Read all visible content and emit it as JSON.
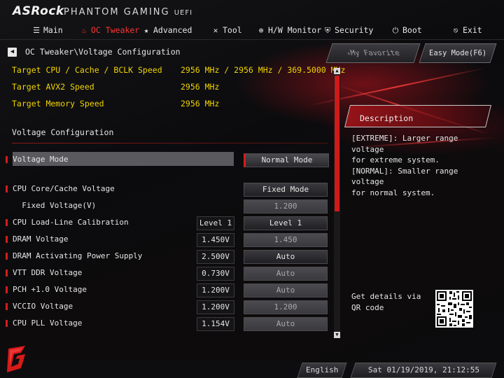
{
  "header": {
    "brand": "ASRock",
    "product": "PHANTOM GAMING",
    "uefi": "UEFI"
  },
  "nav": {
    "items": [
      {
        "label": "Main",
        "icon": "list-icon"
      },
      {
        "label": "OC Tweaker",
        "icon": "flame-icon",
        "active": true
      },
      {
        "label": "Advanced",
        "icon": "star-icon"
      },
      {
        "label": "Tool",
        "icon": "tool-icon"
      },
      {
        "label": "H/W Monitor",
        "icon": "monitor-icon"
      },
      {
        "label": "Security",
        "icon": "shield-icon"
      },
      {
        "label": "Boot",
        "icon": "power-icon"
      },
      {
        "label": "Exit",
        "icon": "exit-icon"
      }
    ]
  },
  "breadcrumb": "OC Tweaker\\Voltage Configuration",
  "buttons": {
    "my_favorite": "My Favorite",
    "easy_mode": "Easy Mode(F6)"
  },
  "info": [
    {
      "label": "Target CPU / Cache / BCLK Speed",
      "value": "2956 MHz / 2956 MHz / 369.5000 MHz"
    },
    {
      "label": "Target AVX2 Speed",
      "value": "2956 MHz"
    },
    {
      "label": "Target Memory Speed",
      "value": "2956 MHz"
    }
  ],
  "section_title": "Voltage Configuration",
  "settings": [
    {
      "label": "Voltage Mode",
      "current": "",
      "value": "Normal Mode",
      "selected": true,
      "marker": true
    },
    {
      "label": "CPU Core/Cache Voltage",
      "current": "",
      "value": "Fixed Mode",
      "marker": true
    },
    {
      "label": "  Fixed Voltage(V)",
      "current": "",
      "value": "1.200",
      "dim": true,
      "marker": false
    },
    {
      "label": "CPU Load-Line Calibration",
      "current": "Level 1",
      "value": "Level 1",
      "marker": true
    },
    {
      "label": "DRAM Voltage",
      "current": "1.450V",
      "value": "1.450",
      "dim": true,
      "marker": true
    },
    {
      "label": "DRAM Activating Power Supply",
      "current": "2.500V",
      "value": "Auto",
      "marker": true
    },
    {
      "label": "VTT DDR Voltage",
      "current": "0.730V",
      "value": "Auto",
      "dim": true,
      "marker": true
    },
    {
      "label": "PCH +1.0 Voltage",
      "current": "1.200V",
      "value": "Auto",
      "dim": true,
      "marker": true
    },
    {
      "label": "VCCIO Voltage",
      "current": "1.200V",
      "value": "1.200",
      "dim": true,
      "marker": true
    },
    {
      "label": "CPU PLL Voltage",
      "current": "1.154V",
      "value": "Auto",
      "dim": true,
      "marker": true
    }
  ],
  "description": {
    "title": "Description",
    "lines": [
      "[EXTREME]: Larger range voltage",
      "for extreme system.",
      "[NORMAL]: Smaller range voltage",
      "for normal system."
    ]
  },
  "qr_label": "Get details via QR code",
  "footer": {
    "language": "English",
    "datetime": "Sat 01/19/2019, 21:12:55"
  },
  "colors": {
    "accent": "#d61c1c",
    "info_text": "#f0d400",
    "active_nav": "#ff3434"
  }
}
